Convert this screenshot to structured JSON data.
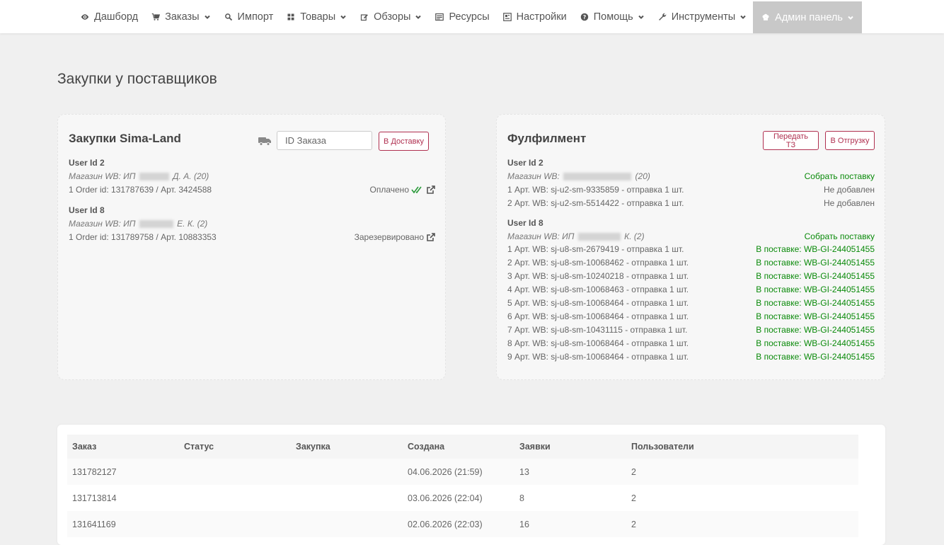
{
  "nav": {
    "items": [
      {
        "label": "Дашборд",
        "icon": "eye-icon",
        "dropdown": false
      },
      {
        "label": "Заказы",
        "icon": "cart-icon",
        "dropdown": true
      },
      {
        "label": "Импорт",
        "icon": "search-icon",
        "dropdown": false
      },
      {
        "label": "Товары",
        "icon": "grid-icon",
        "dropdown": true
      },
      {
        "label": "Обзоры",
        "icon": "edit-icon",
        "dropdown": true
      },
      {
        "label": "Ресурсы",
        "icon": "list-icon",
        "dropdown": false
      },
      {
        "label": "Настройки",
        "icon": "settings-icon",
        "dropdown": false
      },
      {
        "label": "Помощь",
        "icon": "help-icon",
        "dropdown": true
      },
      {
        "label": "Инструменты",
        "icon": "wrench-icon",
        "dropdown": true
      },
      {
        "label": "Админ панель",
        "icon": "chef-icon",
        "dropdown": true,
        "active": true
      }
    ]
  },
  "page": {
    "title": "Закупки у поставщиков"
  },
  "sima": {
    "title": "Закупки Sima-Land",
    "order_input_placeholder": "ID Заказа",
    "deliver_button": "В Доставку",
    "users": [
      {
        "head": "User Id 2",
        "shop_prefix": "Магазин WB: ИП",
        "shop_suffix": "Д. А. (20)",
        "order_line": "1 Order id: 131787639 / Арт. 3424588",
        "status": "Оплачено"
      },
      {
        "head": "User Id 8",
        "shop_prefix": "Магазин WB: ИП",
        "shop_suffix": "Е. К. (2)",
        "order_line": "1 Order id: 131789758 / Арт. 10883353",
        "status": "Зарезервировано"
      }
    ]
  },
  "ful": {
    "title": "Фулфилмент",
    "btn_tz": "Передать ТЗ",
    "btn_ship": "В Отгрузку",
    "users": [
      {
        "head": "User Id 2",
        "shop_prefix": "Магазин WB:",
        "shop_suffix": "(20)",
        "action": "Собрать поставку",
        "lines": [
          {
            "text": "1 Арт. WB: sj-u2-sm-9335859 - отправка 1 шт.",
            "status": "Не добавлен",
            "ok": false
          },
          {
            "text": "2 Арт. WB: sj-u2-sm-5514422 - отправка 1 шт.",
            "status": "Не добавлен",
            "ok": false
          }
        ]
      },
      {
        "head": "User Id 8",
        "shop_prefix": "Магазин WB: ИП",
        "shop_suffix": "К. (2)",
        "action": "Собрать поставку",
        "lines": [
          {
            "text": "1 Арт. WB: sj-u8-sm-2679419 - отправка 1 шт.",
            "status": "В поставке: WB-GI-244051455",
            "ok": true
          },
          {
            "text": "2 Арт. WB: sj-u8-sm-10068462 - отправка 1 шт.",
            "status": "В поставке: WB-GI-244051455",
            "ok": true
          },
          {
            "text": "3 Арт. WB: sj-u8-sm-10240218 - отправка 1 шт.",
            "status": "В поставке: WB-GI-244051455",
            "ok": true
          },
          {
            "text": "4 Арт. WB: sj-u8-sm-10068463 - отправка 1 шт.",
            "status": "В поставке: WB-GI-244051455",
            "ok": true
          },
          {
            "text": "5 Арт. WB: sj-u8-sm-10068464 - отправка 1 шт.",
            "status": "В поставке: WB-GI-244051455",
            "ok": true
          },
          {
            "text": "6 Арт. WB: sj-u8-sm-10068464 - отправка 1 шт.",
            "status": "В поставке: WB-GI-244051455",
            "ok": true
          },
          {
            "text": "7 Арт. WB: sj-u8-sm-10431115 - отправка 1 шт.",
            "status": "В поставке: WB-GI-244051455",
            "ok": true
          },
          {
            "text": "8 Арт. WB: sj-u8-sm-10068464 - отправка 1 шт.",
            "status": "В поставке: WB-GI-244051455",
            "ok": true
          },
          {
            "text": "9 Арт. WB: sj-u8-sm-10068464 - отправка 1 шт.",
            "status": "В поставке: WB-GI-244051455",
            "ok": true
          }
        ]
      }
    ]
  },
  "table": {
    "headers": [
      "Заказ",
      "Статус",
      "Закупка",
      "Создана",
      "Заявки",
      "Пользователи"
    ],
    "rows": [
      [
        "131782127",
        "",
        "",
        "04.06.2026 (21:59)",
        "13",
        "2"
      ],
      [
        "131713814",
        "",
        "",
        "03.06.2026 (22:04)",
        "8",
        "2"
      ],
      [
        "131641169",
        "",
        "",
        "02.06.2026 (22:03)",
        "16",
        "2"
      ]
    ]
  },
  "colors": {
    "accent_button": "#b03050",
    "ok_green": "#0a8a0a",
    "active_nav": "#c8c8c8"
  }
}
